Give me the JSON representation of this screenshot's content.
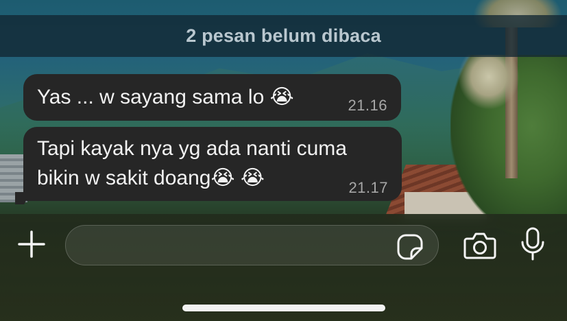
{
  "banner": {
    "unread_label": "2 pesan belum dibaca"
  },
  "messages": [
    {
      "text": "Yas ... w sayang sama lo 😭",
      "time": "21.16"
    },
    {
      "text": "Tapi kayak nya yg ada nanti cuma\nbikin w sakit doang😭 😭",
      "time": "21.17"
    }
  ],
  "composer": {
    "plus_label": "+",
    "input_value": "",
    "icons": [
      "plus-icon",
      "sticker-icon",
      "camera-icon",
      "microphone-icon"
    ]
  },
  "colors": {
    "bubble": "#262626",
    "banner_text": "#b9c7cf",
    "timestamp": "#a7a7a7"
  }
}
